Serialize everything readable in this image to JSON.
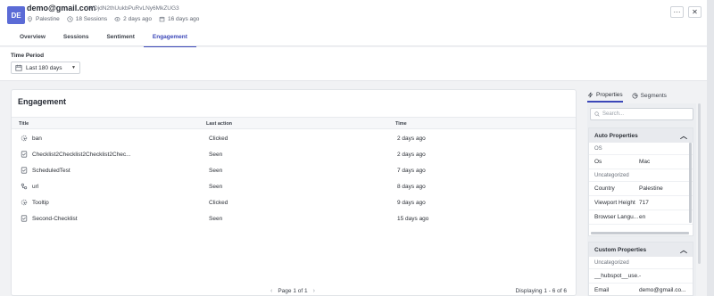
{
  "header": {
    "avatar_initials": "DE",
    "email": "demo@gmail.com",
    "user_id": "hVDjdN2thUukbPuRvLNy6MkZUG3",
    "location": "Palestine",
    "sessions": "18 Sessions",
    "last_seen": "2 days ago",
    "first_seen": "16 days ago",
    "more_label": "···",
    "close_label": "✕"
  },
  "tabs": [
    "Overview",
    "Sessions",
    "Sentiment",
    "Engagement"
  ],
  "active_tab": "Engagement",
  "filters": {
    "time_period_label": "Time Period",
    "time_period_value": "Last 180 days"
  },
  "engagement": {
    "title": "Engagement",
    "columns": [
      "Title",
      "Last action",
      "Time"
    ],
    "rows": [
      {
        "icon": "cursor-icon",
        "title": "ban",
        "action": "Clicked",
        "time": "2 days ago"
      },
      {
        "icon": "checklist-icon",
        "title": "Checklist2Checklist2Checklist2Chec...",
        "action": "Seen",
        "time": "2 days ago"
      },
      {
        "icon": "checklist-icon",
        "title": "ScheduledTest",
        "action": "Seen",
        "time": "7 days ago"
      },
      {
        "icon": "url-icon",
        "title": "url",
        "action": "Seen",
        "time": "8 days ago"
      },
      {
        "icon": "cursor-icon",
        "title": "Tooltip",
        "action": "Clicked",
        "time": "9 days ago"
      },
      {
        "icon": "checklist-icon",
        "title": "Second-Checklist",
        "action": "Seen",
        "time": "15 days ago"
      }
    ],
    "pager": "Page 1 of 1",
    "displaying": "Displaying 1 - 6 of 6"
  },
  "right_panel": {
    "tab_properties": "Properties",
    "tab_segments": "Segments",
    "search_placeholder": "Search...",
    "auto_props": {
      "title": "Auto Properties",
      "group1": "OS",
      "os_key": "Os",
      "os_value": "Mac",
      "group2": "Uncategorized",
      "items": [
        {
          "key": "Country",
          "value": "Palestine"
        },
        {
          "key": "Viewport Height",
          "value": "717"
        },
        {
          "key": "Browser Langu...",
          "value": "en"
        }
      ]
    },
    "custom_props": {
      "title": "Custom Properties",
      "group": "Uncategorized",
      "items": [
        {
          "key": "__hubspot__use...",
          "value": "-"
        },
        {
          "key": "Email",
          "value": "demo@gmail.co..."
        }
      ]
    }
  }
}
